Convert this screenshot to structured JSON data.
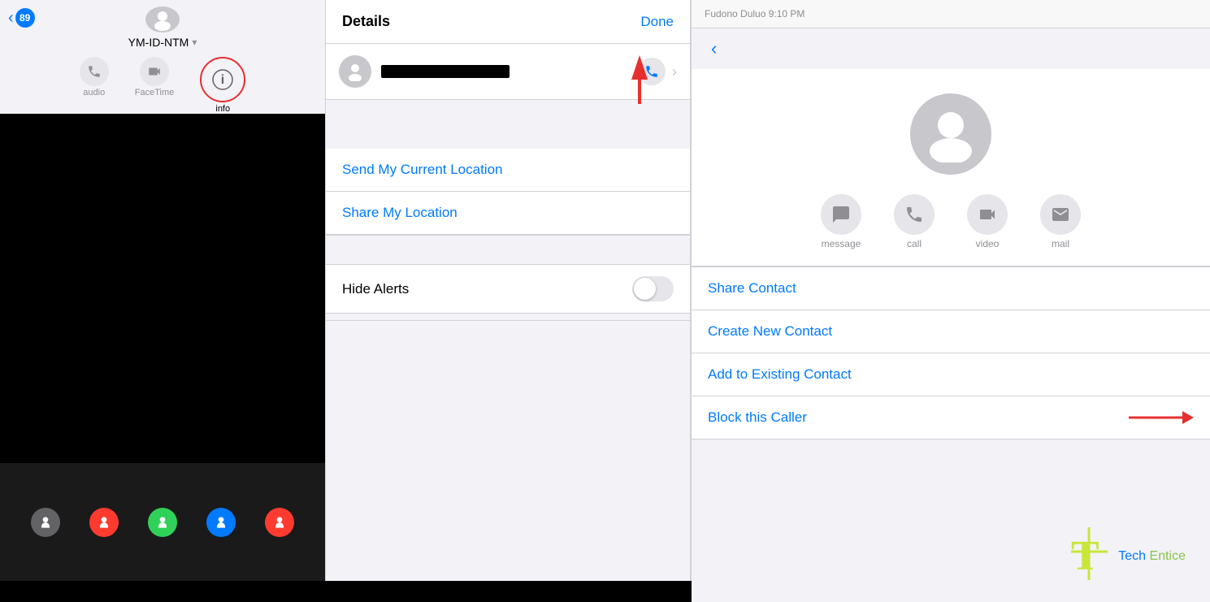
{
  "left": {
    "back_badge": "89",
    "contact_name": "YM-ID-NTM",
    "chevron": "▾",
    "actions": [
      {
        "id": "audio",
        "label": "audio",
        "icon": "phone"
      },
      {
        "id": "facetime",
        "label": "FaceTime",
        "icon": "video"
      },
      {
        "id": "info",
        "label": "info",
        "icon": "ⓘ"
      }
    ]
  },
  "middle": {
    "title": "Details",
    "done_label": "Done",
    "send_location_label": "Send My Current Location",
    "share_location_label": "Share My Location",
    "hide_alerts_label": "Hide Alerts"
  },
  "right": {
    "header_status": "Fudono Duluo    9:10 PM",
    "back_arrow": "‹",
    "action_labels": {
      "message": "message",
      "call": "call",
      "video": "video",
      "mail": "mail"
    },
    "menu_items": {
      "share_contact": "Share Contact",
      "create_new": "Create New Contact",
      "add_existing": "Add to Existing Contact",
      "block_caller": "Block this Caller"
    }
  },
  "watermark": {
    "tech": "Tech",
    "entice": " Entice"
  }
}
